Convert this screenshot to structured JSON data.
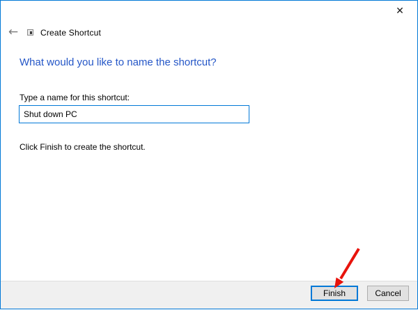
{
  "window": {
    "title": "Create Shortcut"
  },
  "icons": {
    "close": "✕",
    "back": "←",
    "wizard_mini_icon": "shortcut-mini-icon"
  },
  "main": {
    "heading": "What would you like to name the shortcut?",
    "input_label": "Type a name for this shortcut:",
    "input_value": "Shut down PC",
    "instruction": "Click Finish to create the shortcut."
  },
  "footer": {
    "finish_label": "Finish",
    "cancel_label": "Cancel"
  },
  "annotation": {
    "arrow_target": "finish-button",
    "arrow_color": "#e8130c"
  },
  "colors": {
    "window_border": "#0078d7",
    "heading_blue": "#2456c7",
    "input_focus_border": "#0078d7",
    "footer_bg": "#f0f0f0",
    "footer_divider": "#dfdfdf",
    "button_bg": "#e1e1e1",
    "button_border": "#adadad",
    "default_button_border": "#0078d7"
  }
}
